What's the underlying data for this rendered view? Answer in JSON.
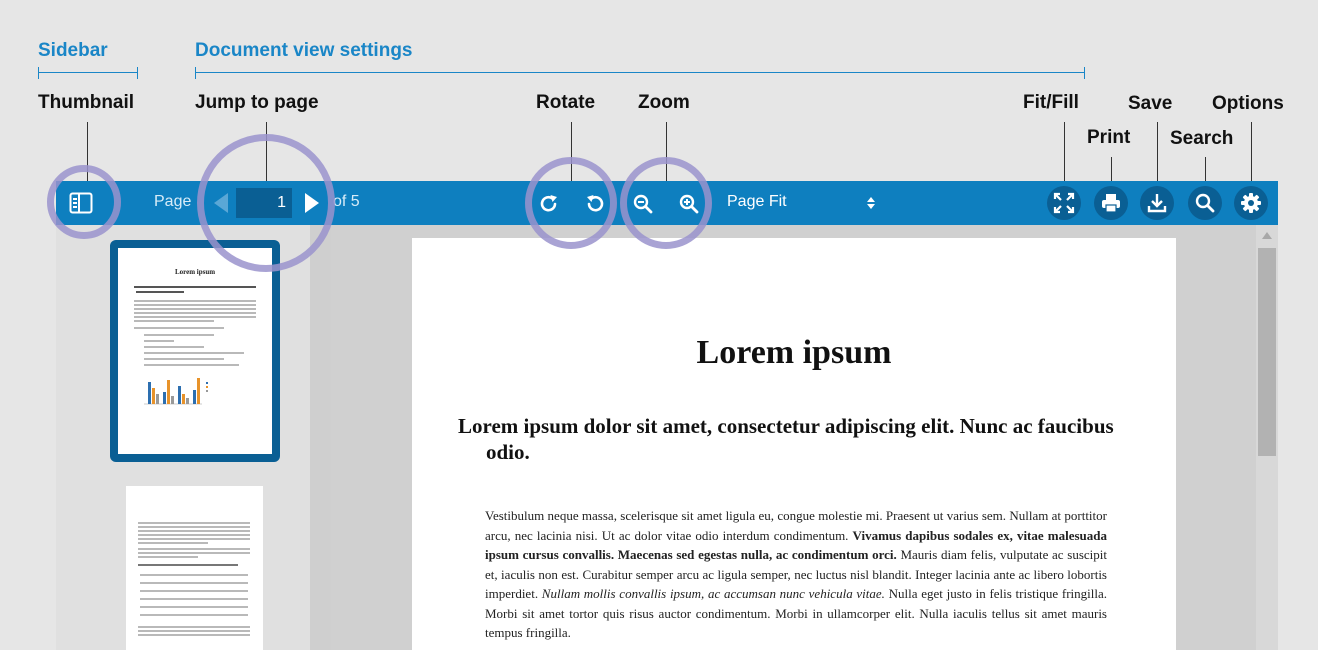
{
  "annotations": {
    "sidebar": "Sidebar",
    "document_view_settings": "Document view settings",
    "thumbnail": "Thumbnail",
    "jump_to_page": "Jump to page",
    "rotate": "Rotate",
    "zoom": "Zoom",
    "fit_fill": "Fit/Fill",
    "print": "Print",
    "save": "Save",
    "search": "Search",
    "options": "Options"
  },
  "toolbar": {
    "page_label": "Page",
    "current_page": "1",
    "of_pages": "of 5",
    "zoom_mode": "Page Fit"
  },
  "document": {
    "title": "Lorem ipsum",
    "subtitle": "Lorem ipsum dolor sit amet, consectetur adipiscing elit. Nunc ac faucibus odio.",
    "para_1": "Vestibulum neque massa, scelerisque sit amet ligula eu, congue molestie mi. Praesent ut varius sem. Nullam at porttitor arcu, nec lacinia nisi. Ut ac dolor vitae odio interdum condimentum. ",
    "para_bold": "Vivamus dapibus sodales ex, vitae malesuada ipsum cursus convallis. Maecenas sed egestas nulla, ac condimentum orci.",
    "para_2": " Mauris diam felis, vulputate ac suscipit et, iaculis non est. Curabitur semper arcu ac ligula semper, nec luctus nisl blandit. Integer lacinia ante ac libero lobortis imperdiet. ",
    "para_italic": "Nullam mollis convallis ipsum, ac accumsan nunc vehicula vitae.",
    "para_3": " Nulla eget justo in felis tristique fringilla. Morbi sit amet tortor quis risus auctor condimentum. Morbi in ullamcorper elit. Nulla iaculis tellus sit amet mauris tempus fringilla."
  },
  "thumbnails": {
    "page1_title": "Lorem ipsum"
  },
  "colors": {
    "toolbar": "#0e7fbf",
    "annotation_blue": "#1a86c7",
    "highlight_circle": "#9a93cc"
  },
  "icons": [
    "sidebar-toggle-icon",
    "prev-page-icon",
    "next-page-icon",
    "rotate-clockwise-icon",
    "rotate-counterclockwise-icon",
    "zoom-out-icon",
    "zoom-in-icon",
    "select-arrows-icon",
    "fit-fill-icon",
    "print-icon",
    "download-icon",
    "search-icon",
    "gear-icon"
  ]
}
